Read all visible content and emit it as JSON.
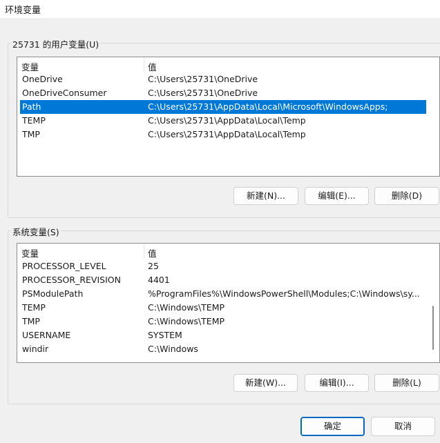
{
  "window": {
    "title": "环境变量"
  },
  "user_vars": {
    "group_label": "25731 的用户变量(U)",
    "columns": [
      "变量",
      "值"
    ],
    "rows": [
      {
        "name": "OneDrive",
        "value": "C:\\Users\\25731\\OneDrive"
      },
      {
        "name": "OneDriveConsumer",
        "value": "C:\\Users\\25731\\OneDrive"
      },
      {
        "name": "Path",
        "value": "C:\\Users\\25731\\AppData\\Local\\Microsoft\\WindowsApps;",
        "selected": true
      },
      {
        "name": "TEMP",
        "value": "C:\\Users\\25731\\AppData\\Local\\Temp"
      },
      {
        "name": "TMP",
        "value": "C:\\Users\\25731\\AppData\\Local\\Temp"
      }
    ],
    "buttons": {
      "new": "新建(N)...",
      "edit": "编辑(E)...",
      "delete": "删除(D)"
    }
  },
  "system_vars": {
    "group_label": "系统变量(S)",
    "columns": [
      "变量",
      "值"
    ],
    "rows": [
      {
        "name": "PROCESSOR_LEVEL",
        "value": "25"
      },
      {
        "name": "PROCESSOR_REVISION",
        "value": "4401"
      },
      {
        "name": "PSModulePath",
        "value": "%ProgramFiles%\\WindowsPowerShell\\Modules;C:\\Windows\\sy..."
      },
      {
        "name": "TEMP",
        "value": "C:\\Windows\\TEMP"
      },
      {
        "name": "TMP",
        "value": "C:\\Windows\\TEMP"
      },
      {
        "name": "USERNAME",
        "value": "SYSTEM"
      },
      {
        "name": "windir",
        "value": "C:\\Windows"
      }
    ],
    "buttons": {
      "new": "新建(W)...",
      "edit": "编辑(I)...",
      "delete": "删除(L)"
    }
  },
  "footer": {
    "ok": "确定",
    "cancel": "取消"
  },
  "colors": {
    "selection": "#0078d7",
    "primary_border": "#0067c0"
  }
}
